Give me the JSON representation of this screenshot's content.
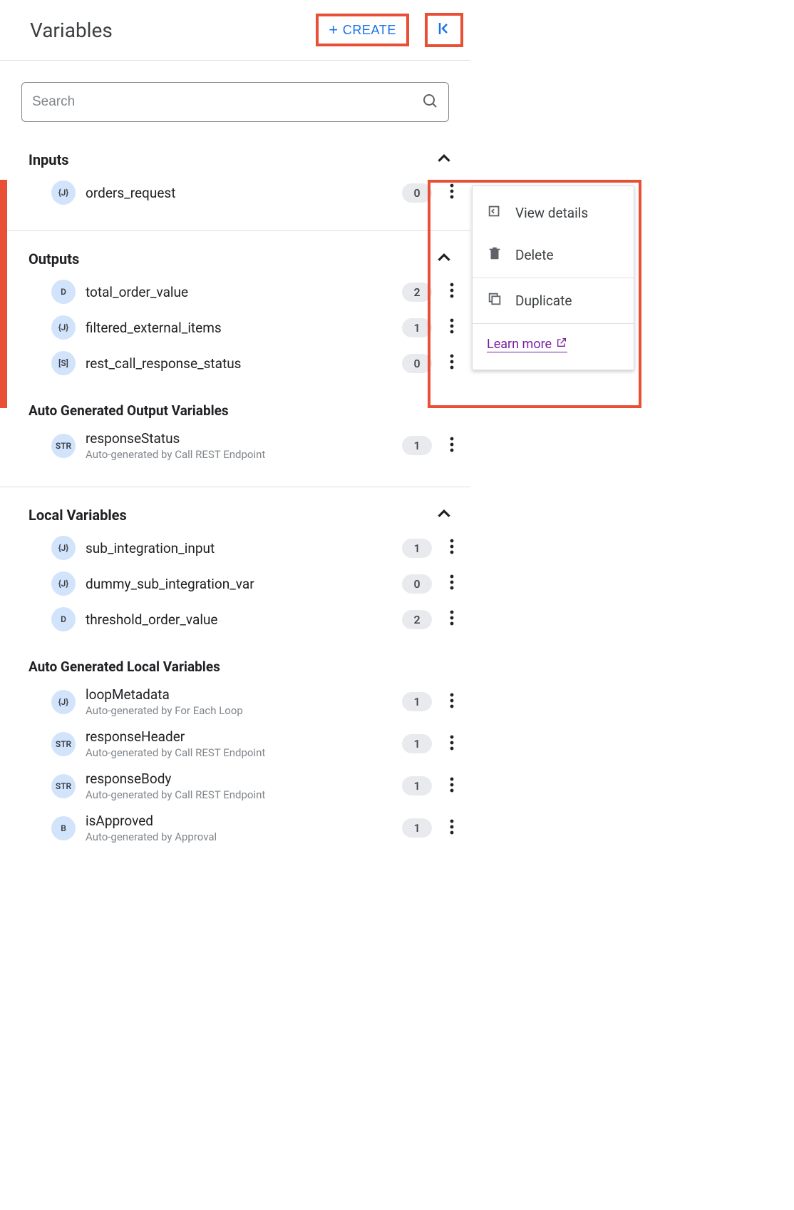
{
  "header": {
    "title": "Variables",
    "create_label": "CREATE"
  },
  "search": {
    "placeholder": "Search"
  },
  "sections": {
    "inputs": {
      "title": "Inputs",
      "items": [
        {
          "type": "{J}",
          "name": "orders_request",
          "count": "0"
        }
      ]
    },
    "outputs": {
      "title": "Outputs",
      "items": [
        {
          "type": "D",
          "name": "total_order_value",
          "count": "2"
        },
        {
          "type": "{J}",
          "name": "filtered_external_items",
          "count": "1"
        },
        {
          "type": "[S]",
          "name": "rest_call_response_status",
          "count": "0"
        }
      ],
      "auto_title": "Auto Generated Output Variables",
      "auto_items": [
        {
          "type": "STR",
          "name": "responseStatus",
          "sub": "Auto-generated by Call REST Endpoint",
          "count": "1"
        }
      ]
    },
    "locals": {
      "title": "Local Variables",
      "items": [
        {
          "type": "{J}",
          "name": "sub_integration_input",
          "count": "1"
        },
        {
          "type": "{J}",
          "name": "dummy_sub_integration_var",
          "count": "0"
        },
        {
          "type": "D",
          "name": "threshold_order_value",
          "count": "2"
        }
      ],
      "auto_title": "Auto Generated Local Variables",
      "auto_items": [
        {
          "type": "{J}",
          "name": "loopMetadata",
          "sub": "Auto-generated by For Each Loop",
          "count": "1"
        },
        {
          "type": "STR",
          "name": "responseHeader",
          "sub": "Auto-generated by Call REST Endpoint",
          "count": "1"
        },
        {
          "type": "STR",
          "name": "responseBody",
          "sub": "Auto-generated by Call REST Endpoint",
          "count": "1"
        },
        {
          "type": "B",
          "name": "isApproved",
          "sub": "Auto-generated by Approval",
          "count": "1"
        }
      ]
    }
  },
  "menu": {
    "view_details": "View details",
    "delete": "Delete",
    "duplicate": "Duplicate",
    "learn_more": "Learn more"
  }
}
